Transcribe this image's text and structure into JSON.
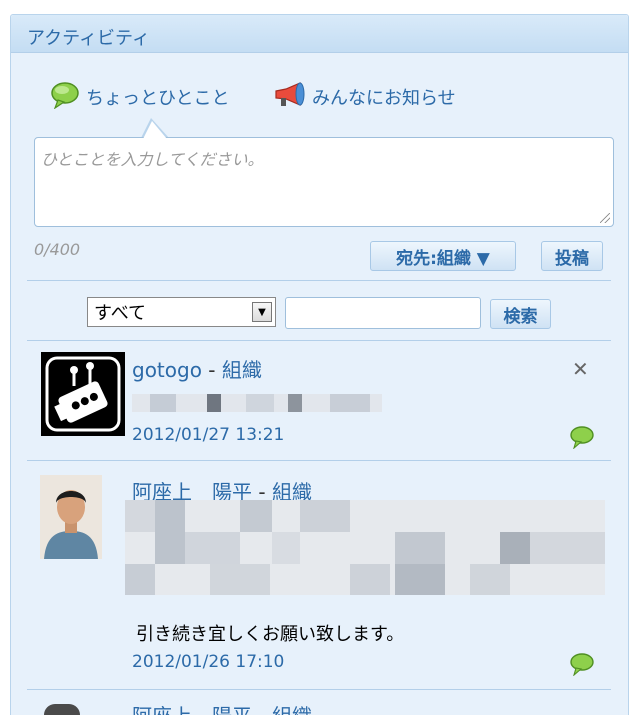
{
  "panel": {
    "title": "アクティビティ"
  },
  "tabs": [
    {
      "label": "ちょっとひとこと",
      "icon": "speech-bubble-icon"
    },
    {
      "label": "みんなにお知らせ",
      "icon": "megaphone-icon"
    }
  ],
  "compose": {
    "placeholder": "ひとことを入力してください。",
    "counter": "0/400"
  },
  "buttons": {
    "destination": "宛先:組織 ▼",
    "post": "投稿",
    "search": "検索"
  },
  "filter": {
    "selected": "すべて",
    "search_value": ""
  },
  "posts": [
    {
      "author": "gotogo",
      "group": "組織",
      "timestamp": "2012/01/27 13:21",
      "message": ""
    },
    {
      "author": "阿座上　陽平",
      "group": "組織",
      "timestamp": "2012/01/26 17:10",
      "message": "引き続き宜しくお願い致します。"
    },
    {
      "author": "阿座上　陽平",
      "group": "組織"
    }
  ],
  "colors": {
    "accent": "#2c6aa8",
    "panel_bg": "#e7f1fb",
    "border": "#b3cfe9",
    "reply_green": "#7fc241"
  }
}
